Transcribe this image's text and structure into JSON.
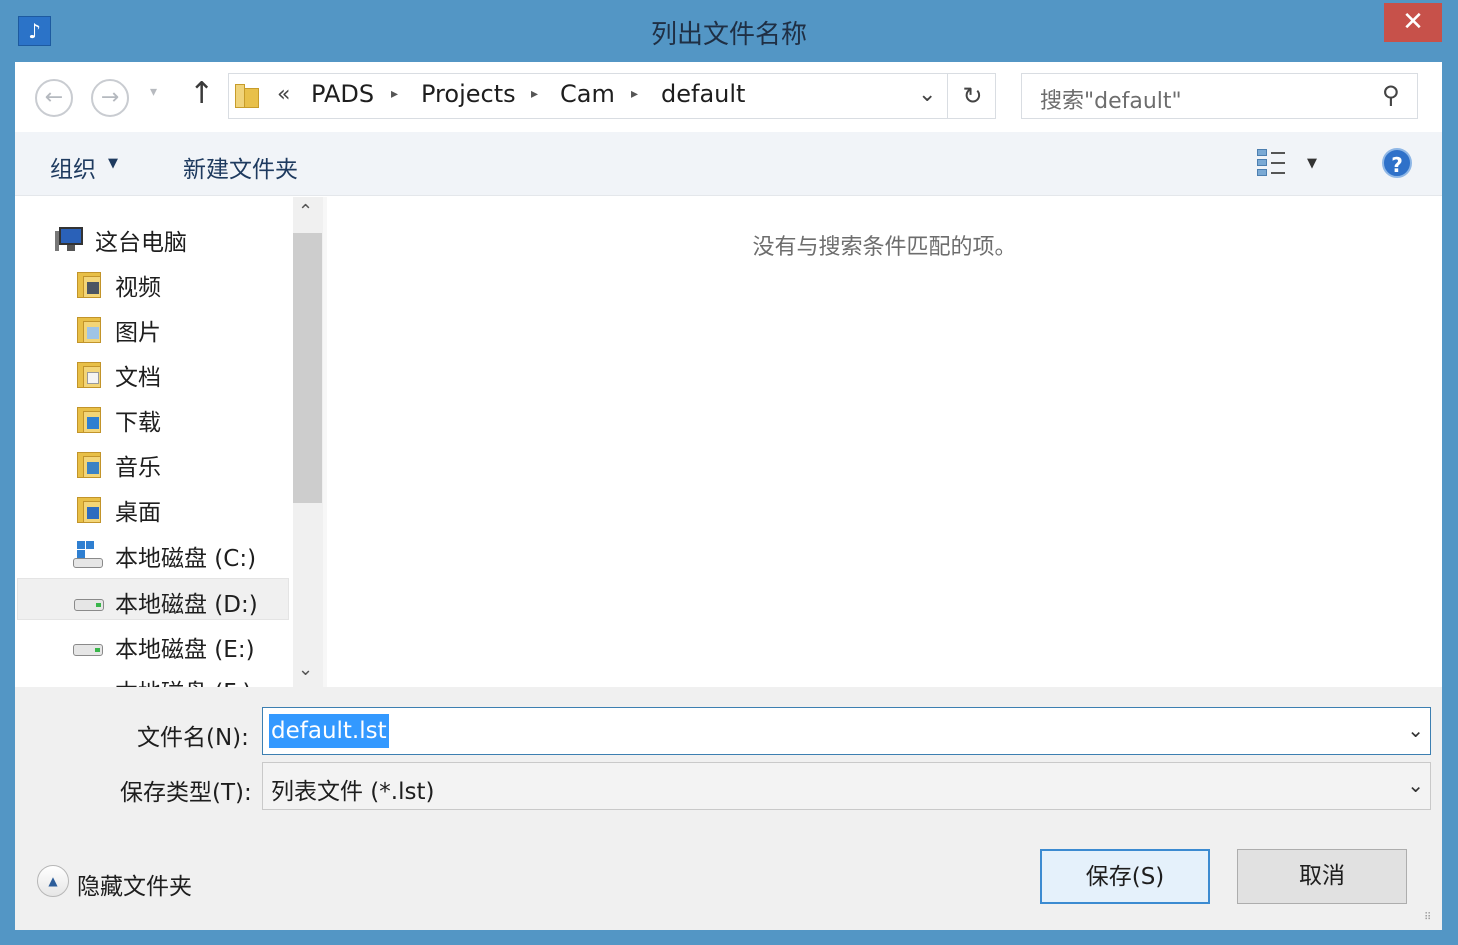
{
  "window": {
    "title": "列出文件名称",
    "close_glyph": "✕"
  },
  "nav": {
    "back_glyph": "←",
    "forward_glyph": "→",
    "recent_glyph": "▾",
    "up_glyph": "↑",
    "address": {
      "overflow": "«",
      "crumbs": [
        "PADS",
        "Projects",
        "Cam",
        "default"
      ],
      "separator": "▸",
      "dropdown_glyph": "⌄",
      "refresh_glyph": "↻"
    },
    "search": {
      "placeholder": "搜索\"default\"",
      "icon_glyph": "⚲"
    }
  },
  "commands": {
    "organize": "组织",
    "organize_arrow": "▼",
    "new_folder": "新建文件夹",
    "view_arrow": "▼",
    "help_glyph": "?"
  },
  "tree": {
    "items": [
      {
        "label": "这台电脑",
        "icon": "computer-icon"
      },
      {
        "label": "视频",
        "icon": "videos-folder-icon"
      },
      {
        "label": "图片",
        "icon": "pictures-folder-icon"
      },
      {
        "label": "文档",
        "icon": "documents-folder-icon"
      },
      {
        "label": "下载",
        "icon": "downloads-folder-icon"
      },
      {
        "label": "音乐",
        "icon": "music-folder-icon"
      },
      {
        "label": "桌面",
        "icon": "desktop-folder-icon"
      },
      {
        "label": "本地磁盘 (C:)",
        "icon": "system-drive-icon"
      },
      {
        "label": "本地磁盘 (D:)",
        "icon": "drive-icon",
        "selected": true
      },
      {
        "label": "本地磁盘 (E:)",
        "icon": "drive-icon"
      },
      {
        "label": "本地磁盘 (F:)",
        "icon": "drive-icon"
      }
    ],
    "scroll_up_glyph": "⌃",
    "scroll_down_glyph": "⌄"
  },
  "filelist": {
    "empty_message": "没有与搜索条件匹配的项。"
  },
  "form": {
    "filename_label": "文件名(N):",
    "filename_value": "default.lst",
    "filetype_label": "保存类型(T):",
    "filetype_value": "列表文件 (*.lst)",
    "combo_arrow": "⌄"
  },
  "footer": {
    "hide_folders": "隐藏文件夹",
    "hide_glyph": "▲",
    "save": "保存(S)",
    "cancel": "取消"
  },
  "colors": {
    "frame": "#5396c5",
    "close": "#c7514a",
    "selection": "#3399ff"
  }
}
